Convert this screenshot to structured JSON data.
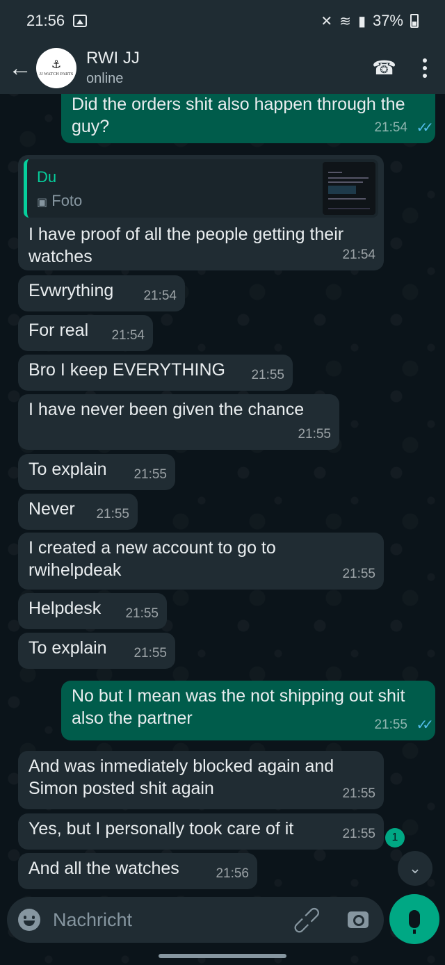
{
  "status_bar": {
    "time": "21:56",
    "battery": "37%"
  },
  "header": {
    "avatar_brand": "JJ WATCH PARTS",
    "contact_name": "RWI JJ",
    "contact_status": "online"
  },
  "messages": [
    {
      "dir": "out",
      "text": "Did the orders shit also happen through the guy?",
      "time": "21:54",
      "ticks": "✓✓"
    },
    {
      "dir": "in",
      "quote_name": "Du",
      "quote_type": "Foto",
      "text": "I have proof of all the people getting their watches",
      "time": "21:54"
    },
    {
      "dir": "in",
      "text": "Evwrything",
      "time": "21:54"
    },
    {
      "dir": "in",
      "text": "For real",
      "time": "21:54"
    },
    {
      "dir": "in",
      "text": "Bro I keep EVERYTHING",
      "time": "21:55"
    },
    {
      "dir": "in",
      "text": "I have never been given the chance",
      "time": "21:55"
    },
    {
      "dir": "in",
      "text": "To explain",
      "time": "21:55"
    },
    {
      "dir": "in",
      "text": "Never",
      "time": "21:55"
    },
    {
      "dir": "in",
      "text": "I created a new account to go to rwihelpdeak",
      "time": "21:55"
    },
    {
      "dir": "in",
      "text": "Helpdesk",
      "time": "21:55"
    },
    {
      "dir": "in",
      "text": "To explain",
      "time": "21:55"
    },
    {
      "dir": "out",
      "text": "No but I mean was the not shipping out shit also the partner",
      "time": "21:55",
      "ticks": "✓✓"
    },
    {
      "dir": "in",
      "text": "And was inmediately blocked again and Simon posted shit again",
      "time": "21:55"
    },
    {
      "dir": "in",
      "text": "Yes, but I personally took care of it",
      "time": "21:55"
    },
    {
      "dir": "in",
      "text": "And all the watches",
      "time": "21:56"
    }
  ],
  "unread_count": "1",
  "composer": {
    "placeholder": "Nachricht"
  },
  "colors": {
    "background": "#0b141a",
    "incoming_bubble": "#202c33",
    "outgoing_bubble": "#005c4b",
    "accent": "#00a884",
    "read_ticks": "#53bdeb"
  },
  "icons": [
    "back-arrow-icon",
    "add-call-icon",
    "more-options-icon",
    "emoji-icon",
    "attach-icon",
    "camera-icon",
    "mic-icon",
    "chevron-down-icon",
    "image-icon"
  ]
}
